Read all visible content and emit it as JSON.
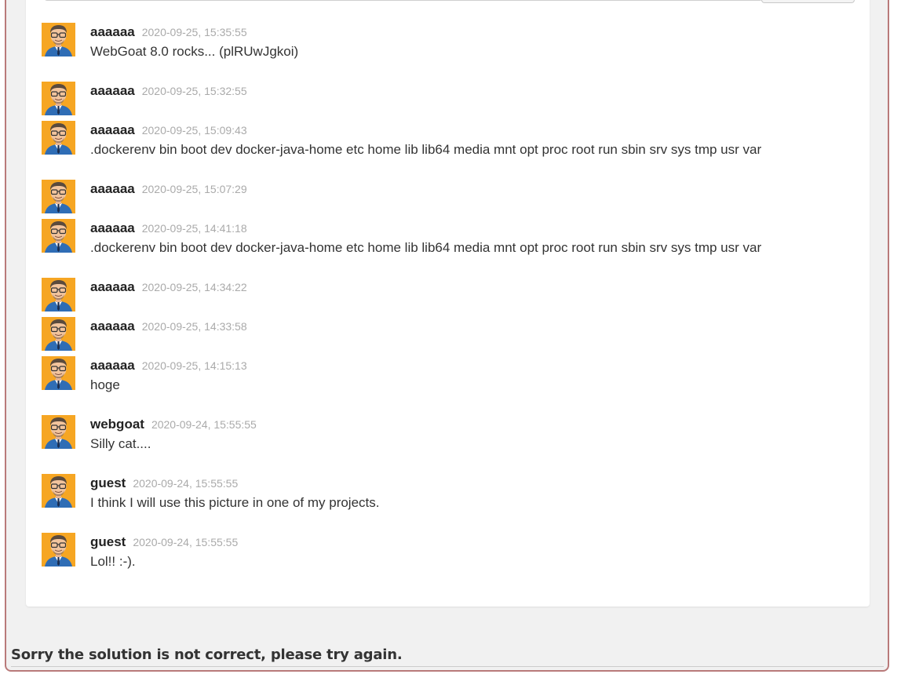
{
  "comments": [
    {
      "user": "aaaaaa",
      "time": "2020-09-25, 15:35:55",
      "text": "WebGoat 8.0 rocks... (plRUwJgkoi)"
    },
    {
      "user": "aaaaaa",
      "time": "2020-09-25, 15:32:55",
      "text": ""
    },
    {
      "user": "aaaaaa",
      "time": "2020-09-25, 15:09:43",
      "text": ".dockerenv bin boot dev docker-java-home etc home lib lib64 media mnt opt proc root run sbin srv sys tmp usr var"
    },
    {
      "user": "aaaaaa",
      "time": "2020-09-25, 15:07:29",
      "text": ""
    },
    {
      "user": "aaaaaa",
      "time": "2020-09-25, 14:41:18",
      "text": ".dockerenv bin boot dev docker-java-home etc home lib lib64 media mnt opt proc root run sbin srv sys tmp usr var"
    },
    {
      "user": "aaaaaa",
      "time": "2020-09-25, 14:34:22",
      "text": ""
    },
    {
      "user": "aaaaaa",
      "time": "2020-09-25, 14:33:58",
      "text": ""
    },
    {
      "user": "aaaaaa",
      "time": "2020-09-25, 14:15:13",
      "text": "hoge"
    },
    {
      "user": "webgoat",
      "time": "2020-09-24, 15:55:55",
      "text": "Silly cat...."
    },
    {
      "user": "guest",
      "time": "2020-09-24, 15:55:55",
      "text": "I think I will use this picture in one of my projects."
    },
    {
      "user": "guest",
      "time": "2020-09-24, 15:55:55",
      "text": "Lol!! :-)."
    }
  ],
  "status_message": "Sorry the solution is not correct, please try again.",
  "avatar_icon": "user-avatar-icon",
  "colors": {
    "avatar_bg": "#f6a623",
    "time": "#aaaaaa",
    "frame_border": "#b97a7a"
  }
}
